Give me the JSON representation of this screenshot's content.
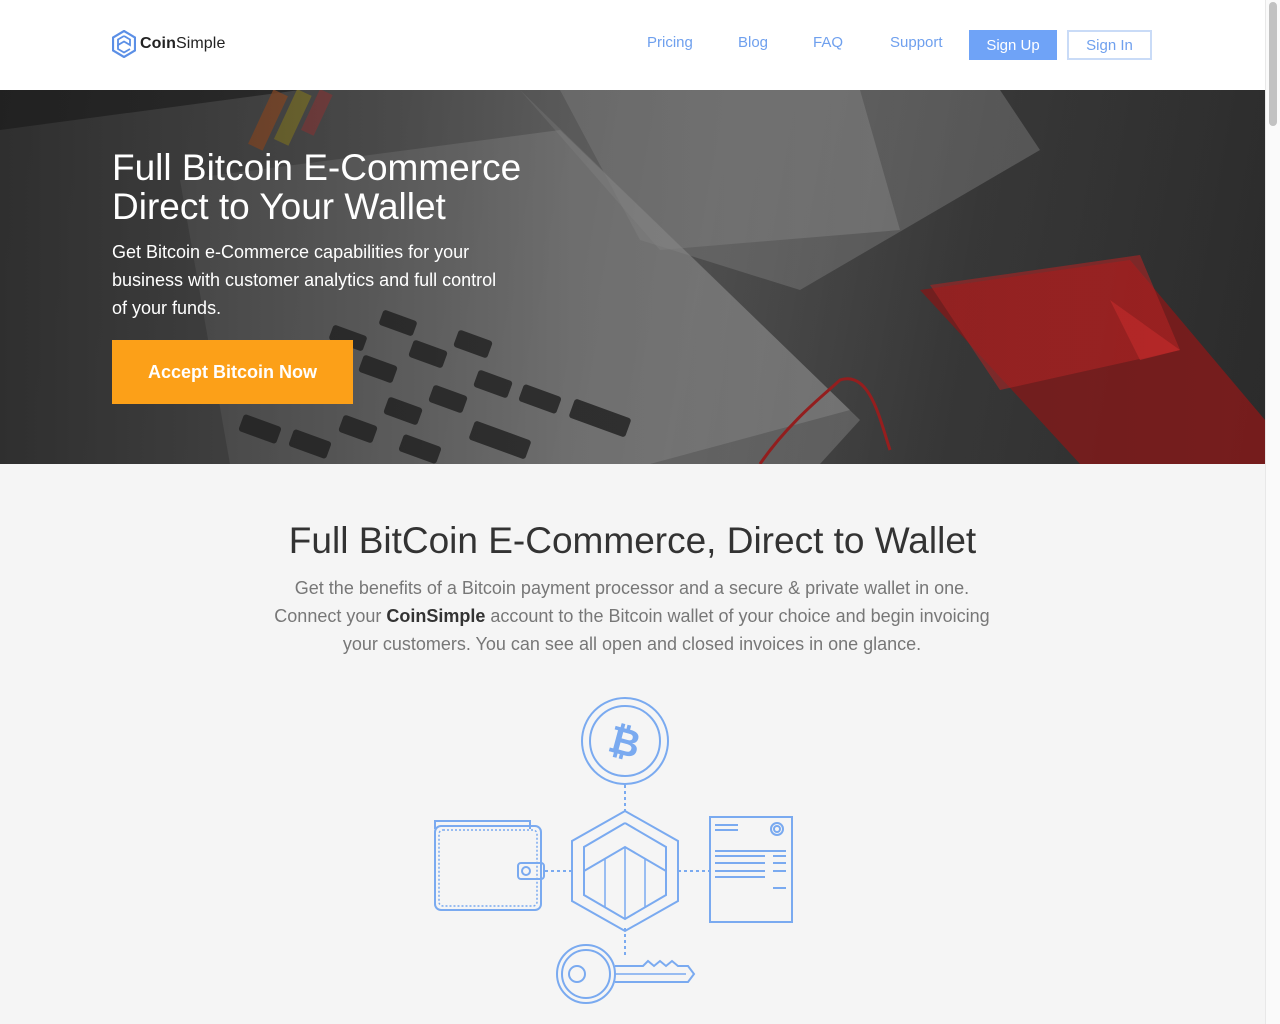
{
  "brand": {
    "name_bold": "Coin",
    "name_rest": "Simple"
  },
  "nav": {
    "pricing": "Pricing",
    "blog": "Blog",
    "faq": "FAQ",
    "support": "Support",
    "sign_up": "Sign Up",
    "sign_in": "Sign In"
  },
  "hero": {
    "title_line1": "Full Bitcoin E-Commerce",
    "title_line2": "Direct to Your Wallet",
    "subtitle": "Get Bitcoin e-Commerce capabilities for your business with customer analytics and full control of your funds.",
    "cta": "Accept Bitcoin Now"
  },
  "features": {
    "title": "Full BitCoin E-Commerce, Direct to Wallet",
    "text_before": "Get the benefits of a Bitcoin payment processor and a secure & private wallet in one. Connect your ",
    "text_bold": "CoinSimple",
    "text_after": " account to the Bitcoin wallet of your choice and begin invoicing your customers. You can see all open and closed invoices in one glance."
  },
  "colors": {
    "accent_blue": "#6fa3f7",
    "cta_orange": "#fca018",
    "illustration_blue": "#7aaaf0"
  },
  "icons": [
    "coinsimple-logo-icon",
    "bitcoin-icon",
    "wallet-icon",
    "hexagon-logo-icon",
    "invoice-icon",
    "key-icon"
  ]
}
